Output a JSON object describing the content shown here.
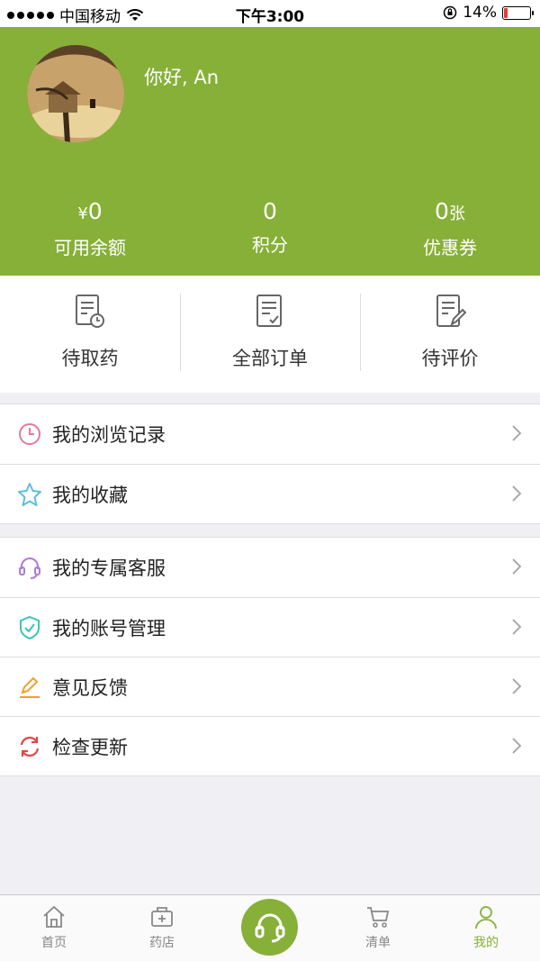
{
  "status_bar": {
    "carrier": "中国移动",
    "time": "下午3:00",
    "battery": "14%",
    "battery_level": 0.14,
    "icons": [
      "signal-icon",
      "wifi-icon",
      "orientation-lock-icon",
      "battery-icon"
    ]
  },
  "profile": {
    "greeting": "你好, An",
    "avatar": "avatar"
  },
  "stats": {
    "balance": {
      "prefix": "¥",
      "value": "0",
      "label": "可用余额"
    },
    "points": {
      "value": "0",
      "label": "积分"
    },
    "coupons": {
      "value": "0",
      "suffix": "张",
      "label": "优惠券"
    }
  },
  "orders": {
    "pending_pickup": {
      "label": "待取药",
      "icon": "clock-document-icon"
    },
    "all_orders": {
      "label": "全部订单",
      "icon": "check-document-icon"
    },
    "pending_review": {
      "label": "待评价",
      "icon": "edit-document-icon"
    }
  },
  "menu": {
    "group1": [
      {
        "label": "我的浏览记录",
        "icon": "clock-icon",
        "color": "#e27aa0"
      },
      {
        "label": "我的收藏",
        "icon": "star-icon",
        "color": "#5bbfe0"
      }
    ],
    "group2": [
      {
        "label": "我的专属客服",
        "icon": "headset-icon",
        "color": "#b07ad8"
      },
      {
        "label": "我的账号管理",
        "icon": "shield-icon",
        "color": "#3cc4b4"
      },
      {
        "label": "意见反馈",
        "icon": "pencil-icon",
        "color": "#f0a030"
      },
      {
        "label": "检查更新",
        "icon": "refresh-icon",
        "color": "#e04848"
      }
    ]
  },
  "tabbar": {
    "home": "首页",
    "pharmacy": "药店",
    "cart": "清单",
    "mine": "我的"
  },
  "colors": {
    "brand": "#87b038",
    "background": "#efeff4"
  }
}
